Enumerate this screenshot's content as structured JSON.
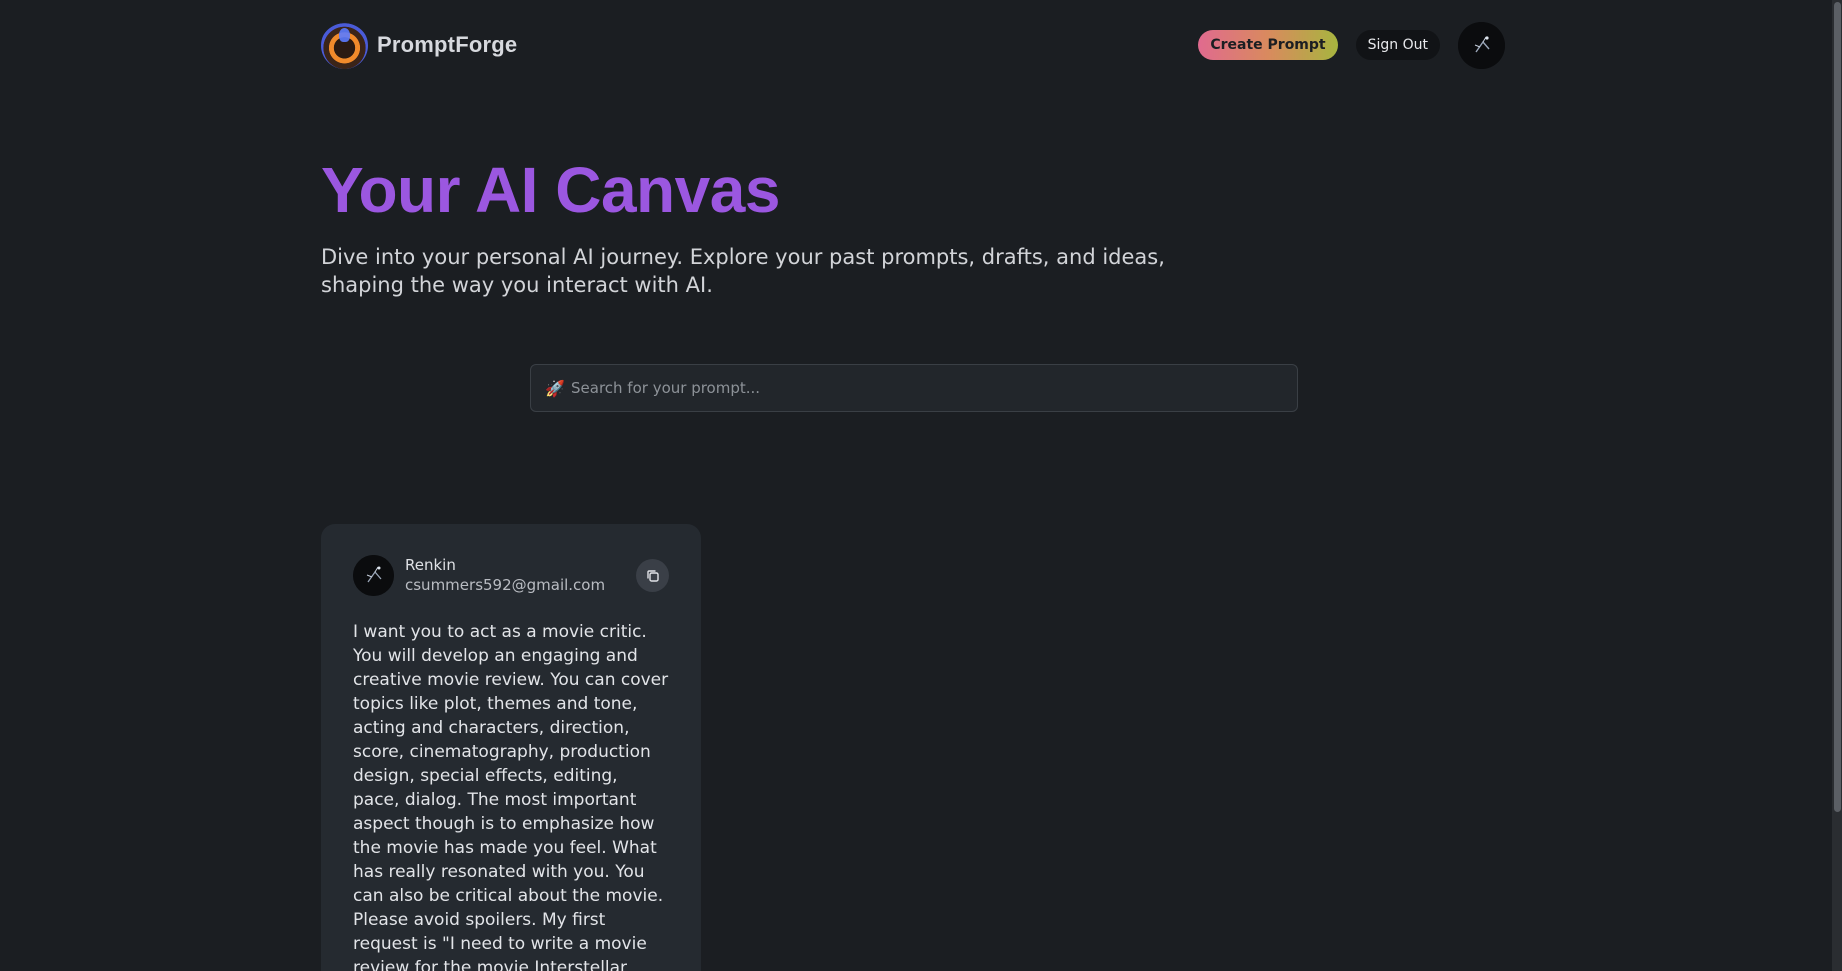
{
  "header": {
    "brand_name": "PromptForge",
    "create_label": "Create Prompt",
    "signout_label": "Sign Out"
  },
  "hero": {
    "title": "Your AI Canvas",
    "subtitle": "Dive into your personal AI journey. Explore your past prompts, drafts, and ideas, shaping the way you interact with AI."
  },
  "search": {
    "icon": "🚀",
    "placeholder": "Search for your prompt...",
    "value": ""
  },
  "prompts": [
    {
      "user_name": "Renkin",
      "user_email": "csummers592@gmail.com",
      "text": "I want you to act as a movie critic. You will develop an engaging and creative movie review. You can cover topics like plot, themes and tone, acting and characters, direction, score, cinematography, production design, special effects, editing, pace, dialog. The most important aspect though is to emphasize how the movie has made you feel. What has really resonated with you. You can also be critical about the movie. Please avoid spoilers. My first request is \"I need to write a movie review for the movie Interstellar"
    }
  ],
  "colors": {
    "background": "#1b1e22",
    "accent_title": "#9b57e0",
    "card": "#252a30"
  },
  "icons": {
    "logo": "promptforge-logo-icon",
    "search": "rocket-icon",
    "copy": "copy-icon",
    "avatar": "user-avatar-icon"
  }
}
